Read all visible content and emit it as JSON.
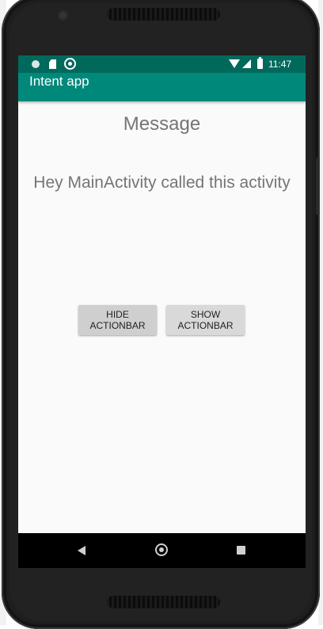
{
  "app": {
    "title": "Intent app"
  },
  "status_bar": {
    "time": "11:47",
    "icons": [
      "circle-notification-icon",
      "sd-card-icon",
      "whatsapp-icon",
      "wifi-icon",
      "signal-icon",
      "battery-charging-icon"
    ]
  },
  "main": {
    "heading": "Message",
    "message": "Hey MainActivity called this activity",
    "buttons": {
      "hide_line1": "HIDE",
      "hide_line2": "ACTIONBAR",
      "show_line1": "SHOW",
      "show_line2": "ACTIONBAR"
    }
  },
  "nav_bar": {
    "icons": [
      "back-icon",
      "home-icon",
      "recents-icon"
    ]
  },
  "colors": {
    "status_bar": "#00695c",
    "app_bar": "#00897b",
    "screen_background": "#fafafa",
    "text_gray": "#757575"
  }
}
